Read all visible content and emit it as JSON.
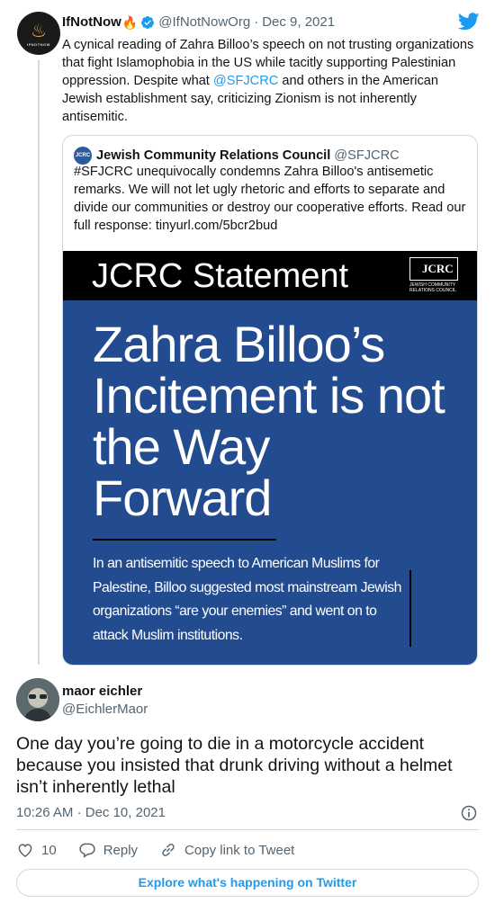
{
  "tweet": {
    "author_name": "IfNotNow",
    "author_emoji": "🔥",
    "author_handle": "@IfNotNowOrg",
    "separator": "·",
    "date": "Dec 9, 2021",
    "avatar_text": "IFNOTNOW",
    "text_before_link": "A cynical reading of Zahra Billoo’s speech on not trusting organizations that fight Islamophobia in the US while tacitly supporting Palestinian oppression. Despite what ",
    "link": "@SFJCRC",
    "text_after_link": " and others in the American Jewish establishment say, criticizing Zionism is not inherently antisemitic."
  },
  "quoted": {
    "author_name": "Jewish Community Relations Council",
    "author_handle": "@SFJCRC",
    "text": "#SFJCRC unequivocally condemns Zahra Billoo's antisemetic remarks. We will not let ugly rhetoric and efforts to separate and divide our communities or destroy our cooperative efforts. Read our full response: tinyurl.com/5bcr2bud",
    "image": {
      "banner_title": "JCRC Statement",
      "logo_text": "JCRC",
      "logo_subtext": "JEWISH COMMUNITY RELATIONS COUNCIL",
      "headline": "Zahra Billoo’s Incitement is not the Way Forward",
      "body": "In an antisemitic speech to American Muslims for Palestine, Billoo suggested most mainstream Jewish organizations “are your enemies” and went on to attack Muslim institutions."
    }
  },
  "reply": {
    "author_name": "maor eichler",
    "author_handle": "@EichlerMaor",
    "text": "One day you’re going to die in a motorcycle accident because you insisted that drunk driving without a helmet isn’t inherently lethal",
    "time": "10:26 AM",
    "separator": "·",
    "date": "Dec 10, 2021"
  },
  "actions": {
    "like_count": "10",
    "reply_label": "Reply",
    "copy_link_label": "Copy link to Tweet"
  },
  "footer": {
    "explore_label": "Explore what's happening on Twitter"
  },
  "icons": {
    "verified": "verified-badge-icon",
    "twitter": "twitter-bird-icon",
    "info": "info-icon",
    "like": "heart-icon",
    "reply": "speech-bubble-icon",
    "copy_link": "link-icon"
  },
  "colors": {
    "accent": "#1d9bf0",
    "secondary_text": "#536471",
    "border": "#cfd9de",
    "image_blue": "#234b8f"
  }
}
